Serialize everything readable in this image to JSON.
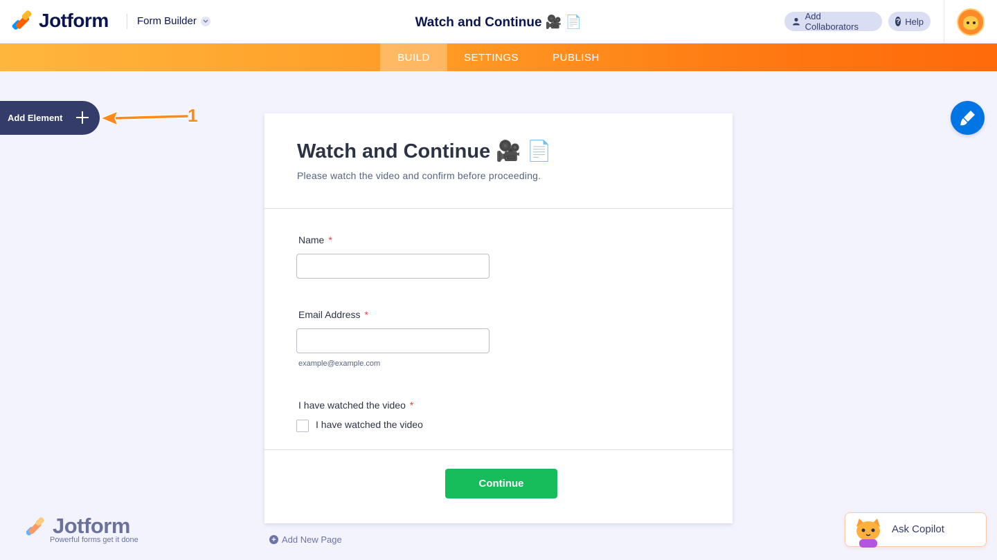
{
  "header": {
    "logo_text": "Jotform",
    "builder_label": "Form Builder",
    "form_title": "Watch and Continue 🎥 📄",
    "collaborators_label": "Add Collaborators",
    "help_label": "Help"
  },
  "nav": {
    "tabs": [
      {
        "label": "BUILD",
        "active": true
      },
      {
        "label": "SETTINGS",
        "active": false
      },
      {
        "label": "PUBLISH",
        "active": false
      }
    ]
  },
  "sidebar": {
    "add_element_label": "Add Element",
    "annotation_number": "1"
  },
  "form": {
    "title": "Watch and Continue 🎥 📄",
    "subtitle": "Please watch the video and confirm before proceeding.",
    "fields": [
      {
        "label": "Name",
        "required_mark": "*",
        "value": ""
      },
      {
        "label": "Email Address",
        "required_mark": "*",
        "value": "",
        "sublabel": "example@example.com"
      },
      {
        "label": "I have watched the video",
        "required_mark": "*",
        "checkbox_label": "I have watched the video",
        "checked": false
      }
    ],
    "submit_label": "Continue"
  },
  "footer": {
    "add_page_label": "Add New Page",
    "logo_text": "Jotform",
    "tagline": "Powerful forms get it done",
    "copilot_label": "Ask Copilot"
  },
  "colors": {
    "brand_navy": "#0a1551",
    "accent_orange": "#ff6100",
    "submit_green": "#18bd5b",
    "paint_blue": "#0075e3",
    "required_red": "#f23a3c"
  },
  "icons": [
    "jotform-logo-icon",
    "chevron-down-icon",
    "user-icon",
    "help-icon",
    "avatar-cat-icon",
    "plus-icon",
    "arrow-annotation-icon",
    "paint-brush-icon",
    "add-page-icon",
    "copilot-cat-icon"
  ]
}
